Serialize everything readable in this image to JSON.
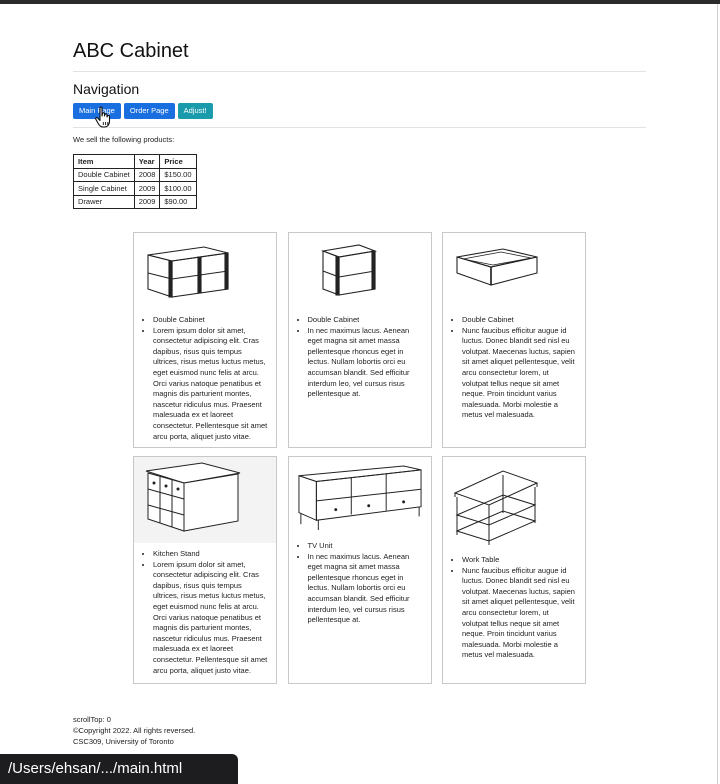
{
  "header": {
    "title": "ABC Cabinet"
  },
  "nav": {
    "title": "Navigation",
    "buttons": [
      {
        "label": "Main Page",
        "color": "#1a6fe0"
      },
      {
        "label": "Order Page",
        "color": "#1a6fe0"
      },
      {
        "label": "Adjust!",
        "color": "#1a9bab"
      }
    ]
  },
  "intro": "We sell the following products:",
  "products_table": {
    "columns": [
      "Item",
      "Year",
      "Price"
    ],
    "rows": [
      [
        "Double Cabinet",
        "2008",
        "$150.00"
      ],
      [
        "Single Cabinet",
        "2009",
        "$100.00"
      ],
      [
        "Drawer",
        "2009",
        "$90.00"
      ]
    ]
  },
  "cards": [
    {
      "icon": "double-cabinet-illustration",
      "name": "Double Cabinet",
      "text": "Lorem ipsum dolor sit amet, consectetur adipiscing elit. Cras dapibus, risus quis tempus ultrices, risus metus luctus metus, eget euismod nunc felis at arcu. Orci varius natoque penatibus et magnis dis parturient montes, nascetur ridiculus mus. Praesent malesuada ex et laoreet consectetur. Pellentesque sit amet arcu porta, aliquet justo vitae."
    },
    {
      "icon": "single-cabinet-illustration",
      "name": "Double Cabinet",
      "text": "In nec maximus lacus. Aenean eget magna sit amet massa pellentesque rhoncus eget in lectus. Nullam lobortis orci eu accumsan blandit. Sed efficitur interdum leo, vel cursus risus pellentesque at."
    },
    {
      "icon": "drawer-illustration",
      "name": "Double Cabinet",
      "text": "Nunc faucibus efficitur augue id luctus. Donec blandit sed nisl eu volutpat. Maecenas luctus, sapien sit amet aliquet pellentesque, velit arcu consectetur lorem, ut volutpat tellus neque sit amet neque. Proin tincidunt varius malesuada. Morbi molestie a metus vel malesuada."
    },
    {
      "icon": "kitchen-stand-illustration",
      "name": "Kitchen Stand",
      "text": "Lorem ipsum dolor sit amet, consectetur adipiscing elit. Cras dapibus, risus quis tempus ultrices, risus metus luctus metus, eget euismod nunc felis at arcu. Orci varius natoque penatibus et magnis dis parturient montes, nascetur ridiculus mus. Praesent malesuada ex et laoreet consectetur. Pellentesque sit amet arcu porta, aliquet justo vitae."
    },
    {
      "icon": "tv-unit-illustration",
      "name": "TV Unit",
      "text": "In nec maximus lacus. Aenean eget magna sit amet massa pellentesque rhoncus eget in lectus. Nullam lobortis orci eu accumsan blandit. Sed efficitur interdum leo, vel cursus risus pellentesque at."
    },
    {
      "icon": "work-table-illustration",
      "name": "Work Table",
      "text": "Nunc faucibus efficitur augue id luctus. Donec blandit sed nisl eu volutpat. Maecenas luctus, sapien sit amet aliquet pellentesque, velit arcu consectetur lorem, ut volutpat tellus neque sit amet neque. Proin tincidunt varius malesuada. Morbi molestie a metus vel malesuada."
    }
  ],
  "footer": {
    "scroll": "scrollTop: 0",
    "copyright": "©Copyright 2022. All rights reversed.",
    "org": "CSC309, University of Toronto"
  },
  "statusbar": {
    "path": "/Users/ehsan/.../main.html"
  }
}
